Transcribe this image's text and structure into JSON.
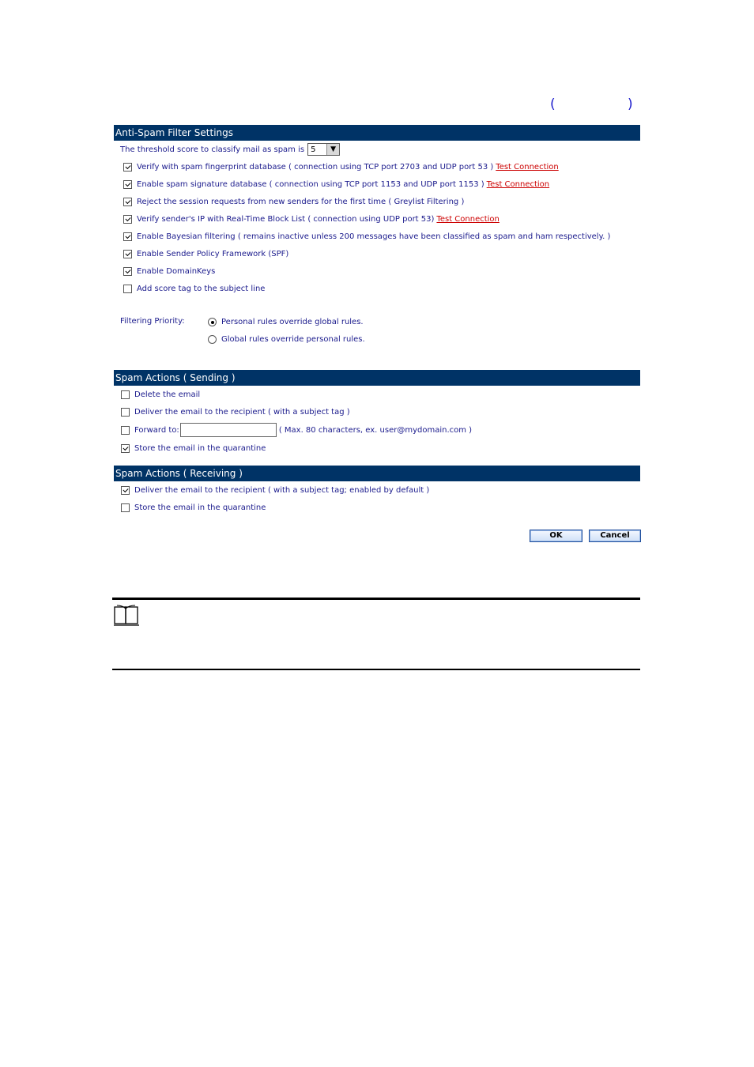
{
  "top_parens": {
    "open": "(",
    "close": ")"
  },
  "filter_settings": {
    "header": "Anti-Spam Filter Settings",
    "threshold": {
      "label": "The threshold score to classify mail as spam is",
      "value": "5"
    },
    "options": [
      {
        "label": "Verify with spam fingerprint database ( connection using TCP port 2703 and UDP port 53 )",
        "link": "Test Connection",
        "checked": true
      },
      {
        "label": "Enable spam signature database ( connection using TCP port 1153 and UDP port 1153 )",
        "link": "Test Connection",
        "checked": true
      },
      {
        "label": "Reject the session requests from new senders for the first time ( Greylist Filtering )",
        "checked": true
      },
      {
        "label": "Verify sender's IP with Real-Time Block List ( connection using UDP port 53)",
        "link": "Test Connection",
        "checked": true
      },
      {
        "label": "Enable Bayesian filtering ( remains inactive unless 200 messages have been classified as spam and ham respectively. )",
        "checked": true
      },
      {
        "label": "Enable Sender Policy Framework (SPF)",
        "checked": true
      },
      {
        "label": "Enable DomainKeys",
        "checked": true
      },
      {
        "label": "Add score tag to the subject line",
        "checked": false
      }
    ],
    "priority": {
      "label": "Filtering Priority:",
      "choices": [
        {
          "label": "Personal rules override global rules.",
          "selected": true
        },
        {
          "label": "Global rules override personal rules.",
          "selected": false
        }
      ]
    }
  },
  "sending": {
    "header": "Spam Actions ( Sending )",
    "delete": {
      "label": "Delete the email",
      "checked": false
    },
    "deliver": {
      "label": "Deliver the email to the recipient ( with a subject tag )",
      "checked": false
    },
    "forward": {
      "label": "Forward to:",
      "value": "",
      "hint": "( Max. 80 characters, ex. user@mydomain.com )",
      "checked": false
    },
    "store": {
      "label": "Store the email in the quarantine",
      "checked": true
    }
  },
  "receiving": {
    "header": "Spam Actions ( Receiving )",
    "deliver": {
      "label": "Deliver the email to the recipient ( with a subject tag; enabled by default )",
      "checked": true
    },
    "store": {
      "label": "Store the email in the quarantine",
      "checked": false
    }
  },
  "buttons": {
    "ok": "OK",
    "cancel": "Cancel"
  },
  "note_icon": "book-icon"
}
